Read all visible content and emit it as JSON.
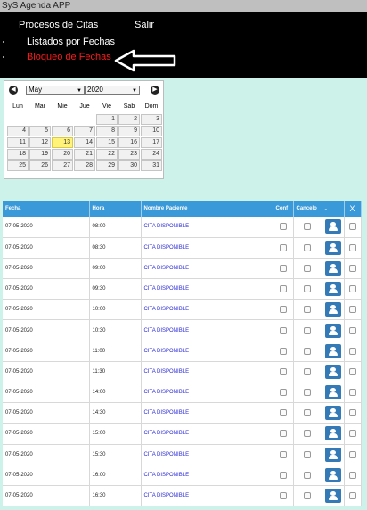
{
  "app": {
    "title": "SyS Agenda APP"
  },
  "menu": {
    "procesos": "Procesos de Citas",
    "salir": "Salir",
    "listados": "Listados por Fechas",
    "bloqueo": "Bloqueo de Fechas"
  },
  "calendar": {
    "month": "May",
    "year": "2020",
    "weekdays": [
      "Lun",
      "Mar",
      "Mie",
      "Jue",
      "Vie",
      "Sab",
      "Dom"
    ],
    "weeks": [
      [
        "",
        "",
        "",
        "",
        "1",
        "2",
        "3"
      ],
      [
        "4",
        "5",
        "6",
        "7",
        "8",
        "9",
        "10"
      ],
      [
        "11",
        "12",
        "13",
        "14",
        "15",
        "16",
        "17"
      ],
      [
        "18",
        "19",
        "20",
        "21",
        "22",
        "23",
        "24"
      ],
      [
        "25",
        "26",
        "27",
        "28",
        "29",
        "30",
        "31"
      ]
    ],
    "highlighted": "13"
  },
  "table": {
    "headers": {
      "fecha": "Fecha",
      "hora": "Hora",
      "paciente": "Nombre Paciente",
      "conf": "Conf",
      "cancelo": "Cancelo",
      "dash": "-",
      "x": "X"
    },
    "rows": [
      {
        "fecha": "07-05-2020",
        "hora": "08:00",
        "paciente": "CITA DISPONIBLE"
      },
      {
        "fecha": "07-05-2020",
        "hora": "08:30",
        "paciente": "CITA DISPONIBLE"
      },
      {
        "fecha": "07-05-2020",
        "hora": "09:00",
        "paciente": "CITA DISPONIBLE"
      },
      {
        "fecha": "07-05-2020",
        "hora": "09:30",
        "paciente": "CITA DISPONIBLE"
      },
      {
        "fecha": "07-05-2020",
        "hora": "10:00",
        "paciente": "CITA DISPONIBLE"
      },
      {
        "fecha": "07-05-2020",
        "hora": "10:30",
        "paciente": "CITA DISPONIBLE"
      },
      {
        "fecha": "07-05-2020",
        "hora": "11:00",
        "paciente": "CITA DISPONIBLE"
      },
      {
        "fecha": "07-05-2020",
        "hora": "11:30",
        "paciente": "CITA DISPONIBLE"
      },
      {
        "fecha": "07-05-2020",
        "hora": "14:00",
        "paciente": "CITA DISPONIBLE"
      },
      {
        "fecha": "07-05-2020",
        "hora": "14:30",
        "paciente": "CITA DISPONIBLE"
      },
      {
        "fecha": "07-05-2020",
        "hora": "15:00",
        "paciente": "CITA DISPONIBLE"
      },
      {
        "fecha": "07-05-2020",
        "hora": "15:30",
        "paciente": "CITA DISPONIBLE"
      },
      {
        "fecha": "07-05-2020",
        "hora": "16:00",
        "paciente": "CITA DISPONIBLE"
      },
      {
        "fecha": "07-05-2020",
        "hora": "16:30",
        "paciente": "CITA DISPONIBLE"
      }
    ]
  },
  "icons": {
    "prev": "chevron-left-icon",
    "next": "chevron-right-icon",
    "arrow": "left-arrow-icon",
    "user": "user-icon"
  },
  "colors": {
    "background": "#ccf2ea",
    "menu_bg": "#000000",
    "active_menu": "#ff1a1a",
    "header_bg": "#3a99d9",
    "user_button": "#337ab7",
    "today": "#fff37a",
    "patient_link": "#2b2bd9"
  }
}
